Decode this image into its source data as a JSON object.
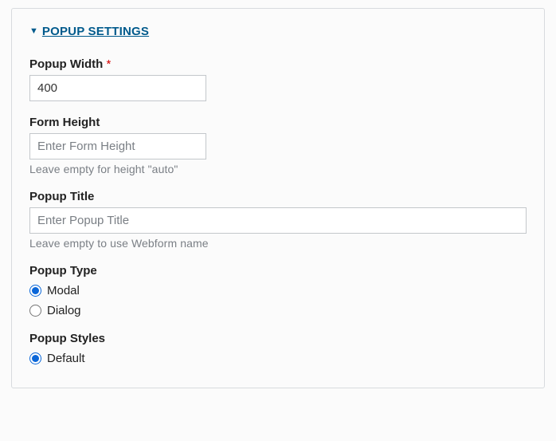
{
  "section": {
    "title": "POPUP SETTINGS"
  },
  "fields": {
    "width": {
      "label": "Popup Width",
      "value": "400"
    },
    "height": {
      "label": "Form Height",
      "value": "",
      "placeholder": "Enter Form Height",
      "hint": "Leave empty for height \"auto\""
    },
    "title": {
      "label": "Popup Title",
      "value": "",
      "placeholder": "Enter Popup Title",
      "hint": "Leave empty to use Webform name"
    },
    "type": {
      "label": "Popup Type",
      "options": {
        "modal": "Modal",
        "dialog": "Dialog"
      }
    },
    "styles": {
      "label": "Popup Styles",
      "options": {
        "default": "Default"
      }
    }
  }
}
